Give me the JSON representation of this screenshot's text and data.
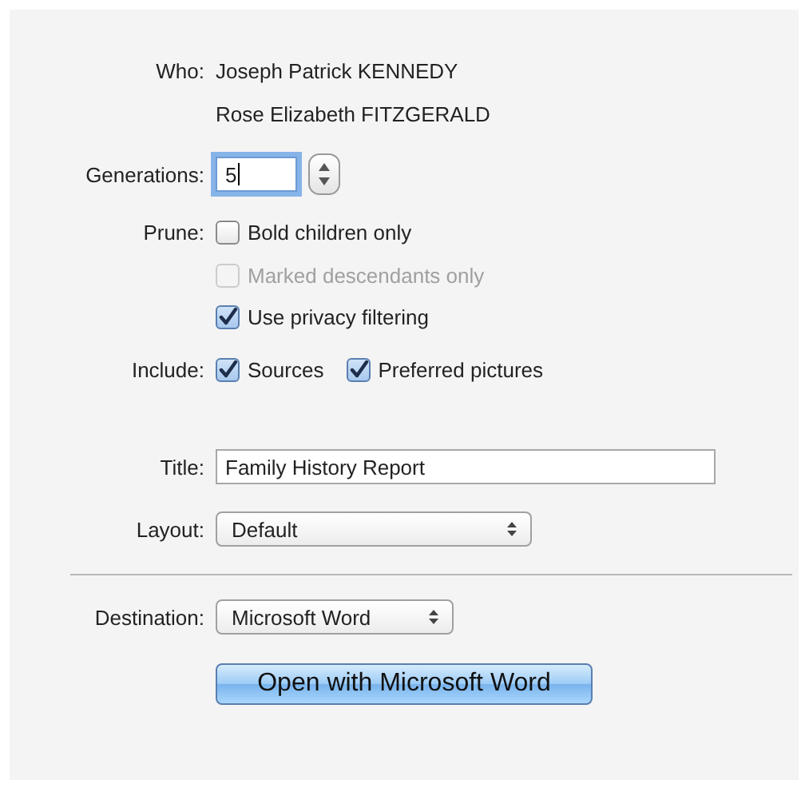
{
  "who": {
    "label": "Who:",
    "names": [
      "Joseph Patrick KENNEDY",
      "Rose Elizabeth FITZGERALD"
    ]
  },
  "generations": {
    "label": "Generations:",
    "value": "5",
    "focused": true
  },
  "prune": {
    "label": "Prune:",
    "options": [
      {
        "label": "Bold children only",
        "checked": false,
        "disabled": false
      },
      {
        "label": "Marked descendants only",
        "checked": false,
        "disabled": true
      },
      {
        "label": "Use privacy filtering",
        "checked": true,
        "disabled": false
      }
    ]
  },
  "include": {
    "label": "Include:",
    "options": [
      {
        "label": "Sources",
        "checked": true,
        "disabled": false
      },
      {
        "label": "Preferred pictures",
        "checked": true,
        "disabled": false
      }
    ]
  },
  "title": {
    "label": "Title:",
    "value": "Family History Report"
  },
  "layout": {
    "label": "Layout:",
    "value": "Default"
  },
  "destination": {
    "label": "Destination:",
    "value": "Microsoft Word"
  },
  "action_button": {
    "label": "Open with Microsoft Word"
  }
}
